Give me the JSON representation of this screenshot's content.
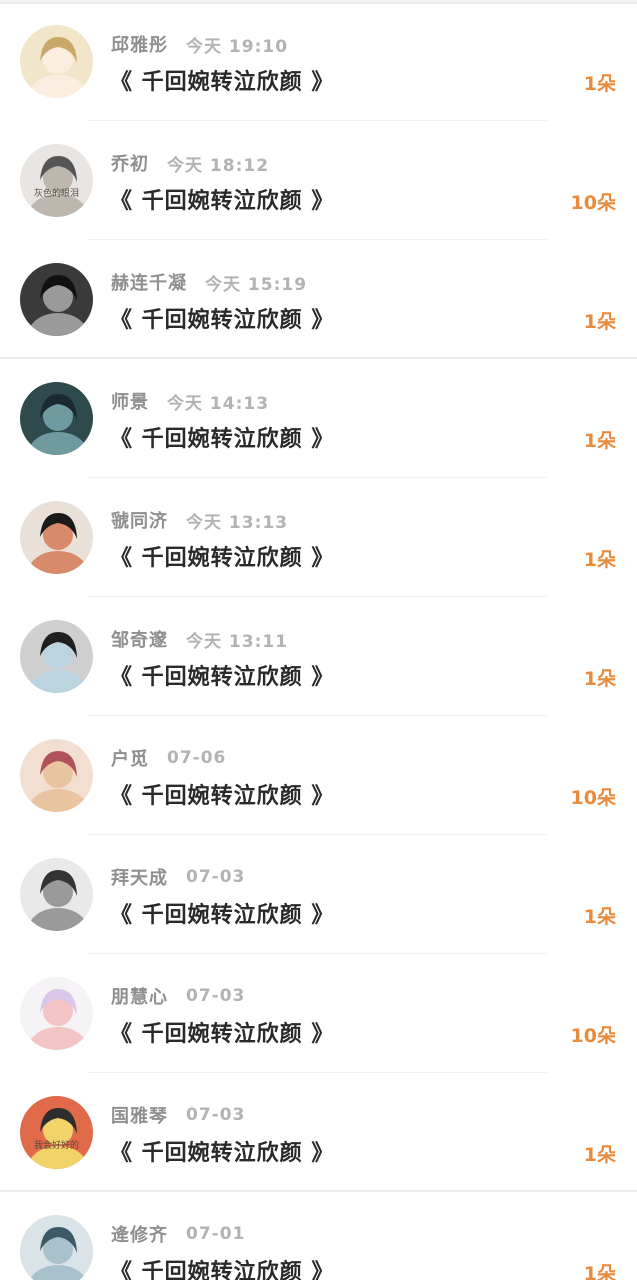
{
  "gifts": [
    {
      "name": "邱雅彤",
      "time": "今天 19:10",
      "title": "《 千回婉转泣欣颜 》",
      "count": "1朵",
      "avatar_colors": [
        "#f1e6c9",
        "#c9a86a",
        "#fbeee0"
      ]
    },
    {
      "name": "乔初",
      "time": "今天 18:12",
      "title": "《 千回婉转泣欣颜 》",
      "count": "10朵",
      "avatar_colors": [
        "#e8e5e2",
        "#555555",
        "#bdb7b0"
      ],
      "avatar_text": "灰色的眼泪"
    },
    {
      "name": "赫连千凝",
      "time": "今天 15:19",
      "title": "《 千回婉转泣欣颜 》",
      "count": "1朵",
      "avatar_colors": [
        "#3a3a3a",
        "#111111",
        "#9a9a9a"
      ]
    },
    {
      "name": "师景",
      "time": "今天 14:13",
      "title": "《 千回婉转泣欣颜 》",
      "count": "1朵",
      "avatar_colors": [
        "#2e4a4c",
        "#1b2a2e",
        "#6f9aa0"
      ]
    },
    {
      "name": "虢同济",
      "time": "今天 13:13",
      "title": "《 千回婉转泣欣颜 》",
      "count": "1朵",
      "avatar_colors": [
        "#e9e1d8",
        "#1a1a1a",
        "#d98a6a"
      ]
    },
    {
      "name": "邹奇邃",
      "time": "今天 13:11",
      "title": "《 千回婉转泣欣颜 》",
      "count": "1朵",
      "avatar_colors": [
        "#cfcfcf",
        "#1f1f1f",
        "#bcd3e0"
      ]
    },
    {
      "name": "户觅",
      "time": "07-06",
      "title": "《 千回婉转泣欣颜 》",
      "count": "10朵",
      "avatar_colors": [
        "#f2dfd2",
        "#b0525a",
        "#e9c4a0"
      ]
    },
    {
      "name": "拜天成",
      "time": "07-03",
      "title": "《 千回婉转泣欣颜 》",
      "count": "1朵",
      "avatar_colors": [
        "#e9e9e9",
        "#333333",
        "#9a9a9a"
      ]
    },
    {
      "name": "朋慧心",
      "time": "07-03",
      "title": "《 千回婉转泣欣颜 》",
      "count": "10朵",
      "avatar_colors": [
        "#f6f3f7",
        "#d8c7e8",
        "#f2c4c4"
      ]
    },
    {
      "name": "国雅琴",
      "time": "07-03",
      "title": "《 千回婉转泣欣颜 》",
      "count": "1朵",
      "avatar_colors": [
        "#e06a4a",
        "#2d2d2d",
        "#f2d36a"
      ],
      "avatar_text": "我会好好的"
    },
    {
      "name": "逄修齐",
      "time": "07-01",
      "title": "《 千回婉转泣欣颜 》",
      "count": "1朵",
      "avatar_colors": [
        "#d9e3e8",
        "#3c5a66",
        "#a9c1cc"
      ]
    }
  ]
}
